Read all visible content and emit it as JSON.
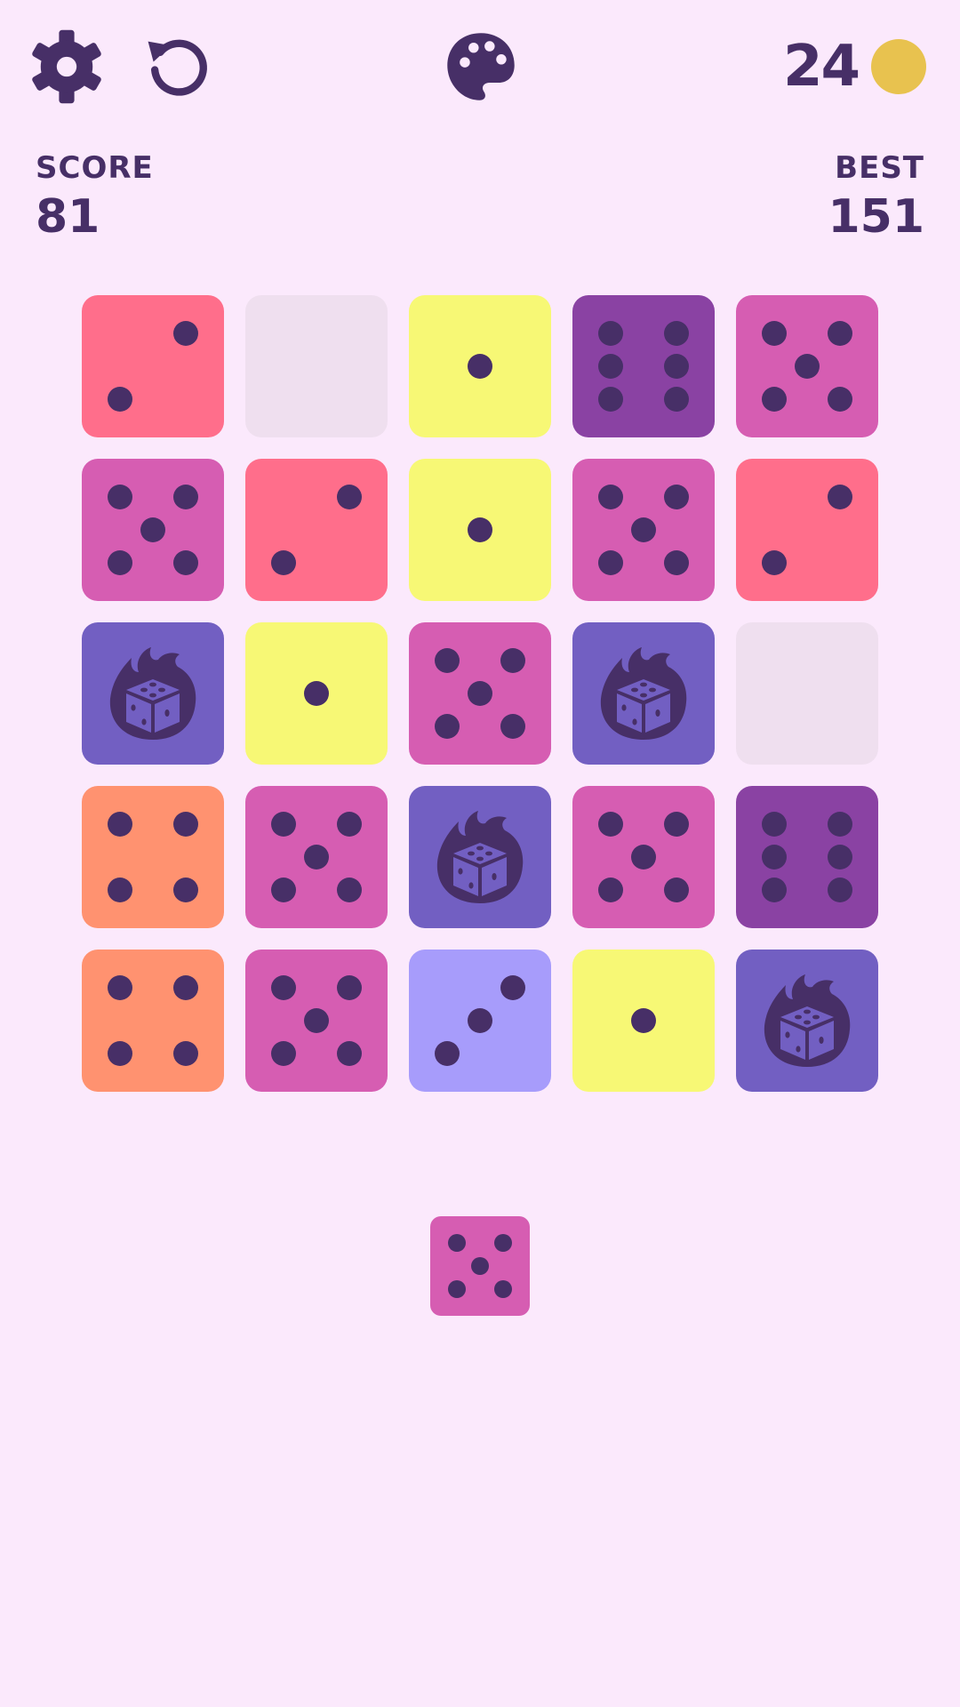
{
  "header": {
    "coins": "24",
    "icons": [
      "gear-icon",
      "restart-icon",
      "palette-icon",
      "coin-icon"
    ]
  },
  "score": {
    "label": "SCORE",
    "value": "81"
  },
  "best": {
    "label": "BEST",
    "value": "151"
  },
  "colors": {
    "background": "#fbe9fc",
    "ink": "#472f67",
    "empty": "#efdfef",
    "coin": "#e8c24f",
    "die_1": "#f7f875",
    "die_2": "#ff6e8b",
    "die_3": "#a79cfb",
    "die_4": "#ff9270",
    "die_5": "#d65db2",
    "die_6": "#8a42a3",
    "special": "#725fc2"
  },
  "board": [
    [
      2,
      0,
      1,
      6,
      5
    ],
    [
      5,
      2,
      1,
      5,
      2
    ],
    [
      "special",
      1,
      5,
      "special",
      0
    ],
    [
      4,
      5,
      "special",
      5,
      6
    ],
    [
      4,
      5,
      3,
      1,
      "special"
    ]
  ],
  "next_die": 5
}
